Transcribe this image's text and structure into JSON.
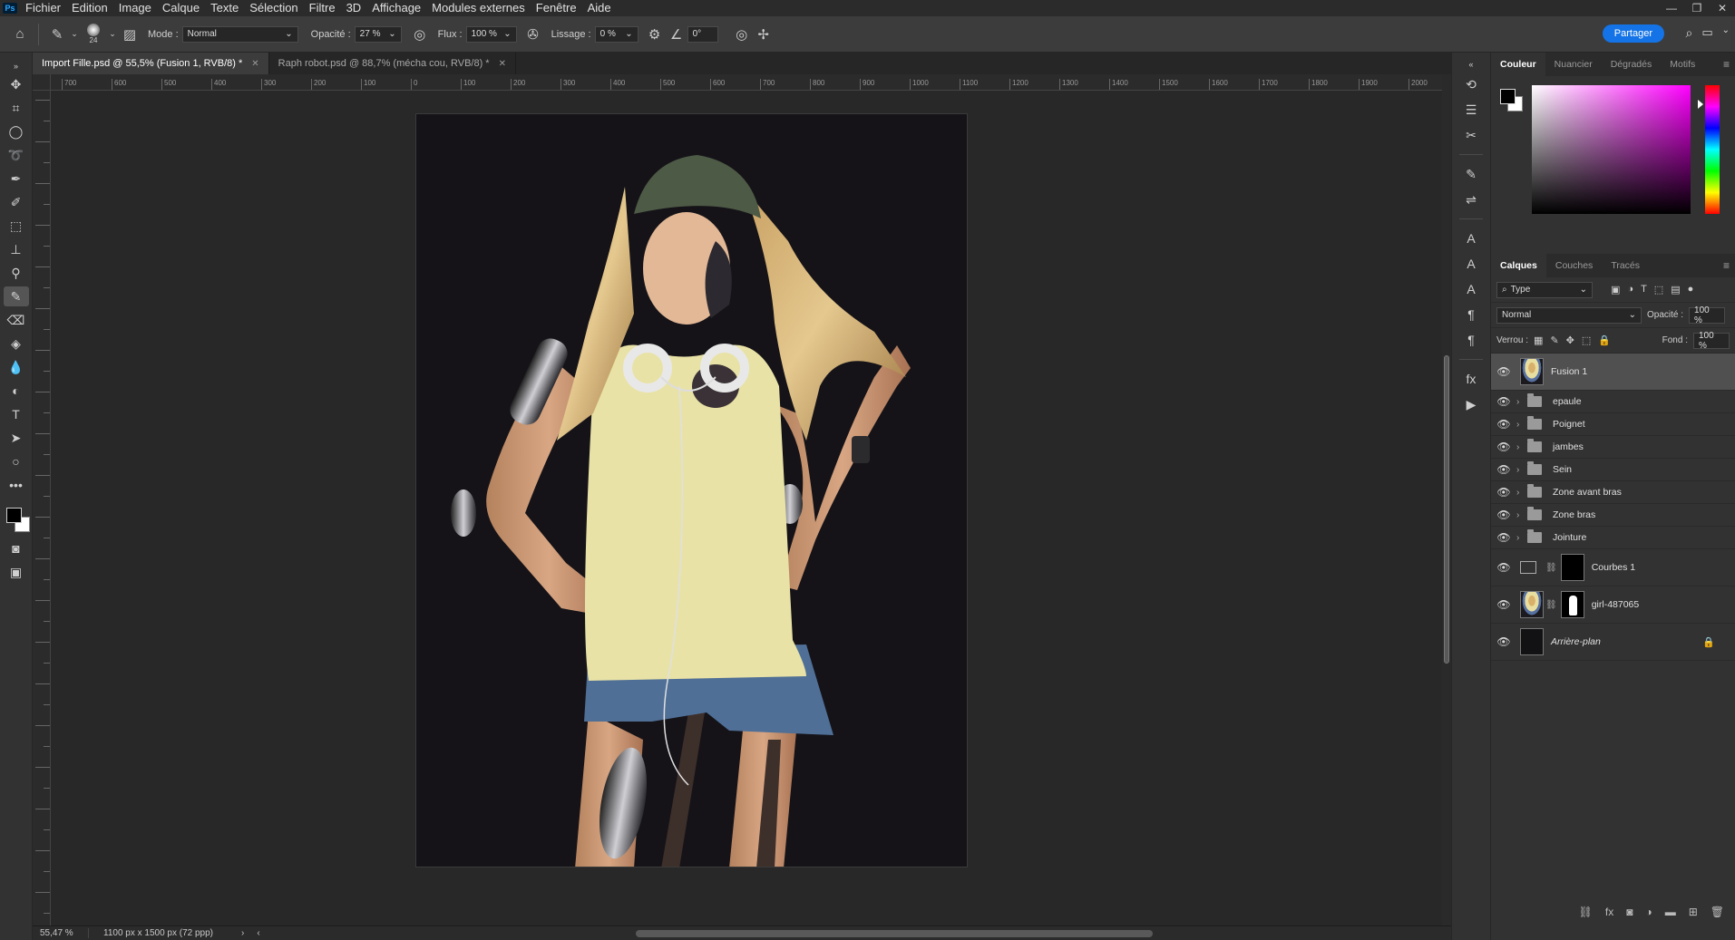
{
  "app": {
    "logo": "Ps"
  },
  "menu": [
    "Fichier",
    "Edition",
    "Image",
    "Calque",
    "Texte",
    "Sélection",
    "Filtre",
    "3D",
    "Affichage",
    "Modules externes",
    "Fenêtre",
    "Aide"
  ],
  "options": {
    "brush_size": "24",
    "mode_label": "Mode :",
    "mode_value": "Normal",
    "opacity_label": "Opacité :",
    "opacity_value": "27 %",
    "flow_label": "Flux :",
    "flow_value": "100 %",
    "smoothing_label": "Lissage :",
    "smoothing_value": "0 %",
    "angle_value": "0°",
    "share_label": "Partager"
  },
  "tabs": [
    {
      "title": "Import Fille.psd @ 55,5% (Fusion 1, RVB/8) *",
      "active": true
    },
    {
      "title": "Raph robot.psd @ 88,7% (mécha cou, RVB/8) *",
      "active": false
    }
  ],
  "ruler": {
    "h_ticks": [
      "700",
      "600",
      "500",
      "400",
      "300",
      "200",
      "100",
      "0",
      "100",
      "200",
      "300",
      "400",
      "500",
      "600",
      "700",
      "800",
      "900",
      "1000",
      "1100",
      "1200",
      "1300",
      "1400",
      "1500",
      "1600",
      "1700",
      "1800",
      "1900",
      "2000"
    ]
  },
  "status": {
    "zoom": "55,47 %",
    "doc_info": "1100 px x 1500 px (72 ppp)"
  },
  "color_panel": {
    "tabs": [
      "Couleur",
      "Nuancier",
      "Dégradés",
      "Motifs"
    ],
    "fg": "#000000",
    "bg": "#ffffff"
  },
  "layers_panel": {
    "tabs": [
      "Calques",
      "Couches",
      "Tracés"
    ],
    "filter_value": "Type",
    "blend_mode": "Normal",
    "opacity_label": "Opacité :",
    "opacity_value": "100 %",
    "lock_label": "Verrou :",
    "fill_label": "Fond :",
    "fill_value": "100 %",
    "layers": [
      {
        "name": "Fusion 1",
        "kind": "pixel",
        "selected": true
      },
      {
        "name": "epaule",
        "kind": "group"
      },
      {
        "name": "Poignet",
        "kind": "group"
      },
      {
        "name": "jambes",
        "kind": "group"
      },
      {
        "name": "Sein",
        "kind": "group"
      },
      {
        "name": "Zone avant bras",
        "kind": "group"
      },
      {
        "name": "Zone bras",
        "kind": "group"
      },
      {
        "name": "Jointure",
        "kind": "group"
      },
      {
        "name": "Courbes 1",
        "kind": "adjustment"
      },
      {
        "name": "girl-487065",
        "kind": "masked"
      },
      {
        "name": "Arrière-plan",
        "kind": "background"
      }
    ]
  }
}
